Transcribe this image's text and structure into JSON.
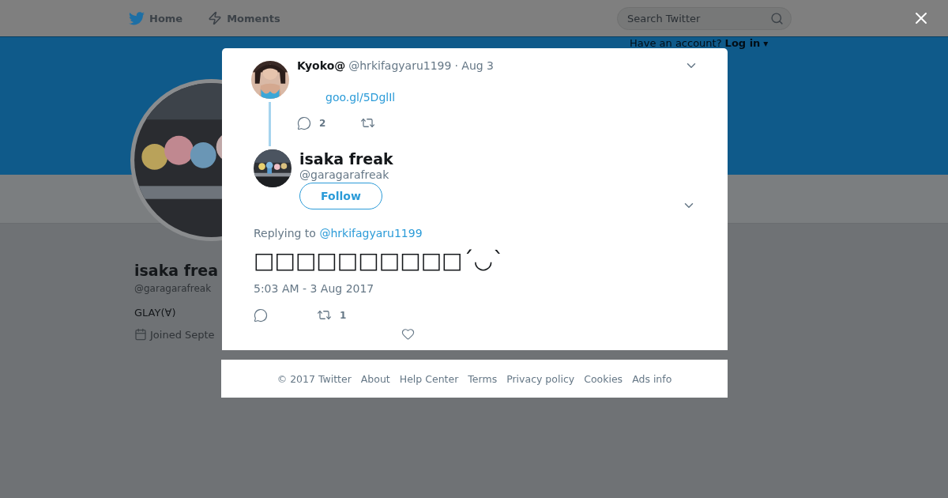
{
  "nav": {
    "items": [
      {
        "label": "Home"
      },
      {
        "label": "Moments"
      }
    ],
    "search": {
      "placeholder": "Search Twitter"
    },
    "login_prompt": {
      "text": "Have an account?",
      "link": "Log in",
      "caret": "▾"
    }
  },
  "profile": {
    "name": "isaka frea",
    "handle": "@garagarafreak",
    "bio": "GLAY(∀)",
    "joined": "Joined Septe"
  },
  "modal": {
    "parent_tweet": {
      "name": "Kyoko@",
      "handle": "@hrkifagyaru1199",
      "time": "· Aug 3",
      "link": "goo.gl/5DglIl",
      "actions": [
        {
          "kind": "reply",
          "count": "2"
        },
        {
          "kind": "retweet"
        }
      ]
    },
    "tweet": {
      "name": "isaka freak",
      "handle": "@garagarafreak",
      "follow": "Follow",
      "replying_label": "Replying to",
      "replying_to": "@hrkifagyaru1199",
      "text": "□□□□□□□□□□´◡`",
      "timestamp": "5:03 AM - 3 Aug 2017",
      "actions": [
        {
          "kind": "reply"
        },
        {
          "kind": "retweet",
          "count": "1"
        },
        {
          "kind": "like"
        }
      ]
    }
  },
  "footer": {
    "links": [
      "© 2017 Twitter",
      "About",
      "Help Center",
      "Terms",
      "Privacy policy",
      "Cookies",
      "Ads info"
    ]
  }
}
